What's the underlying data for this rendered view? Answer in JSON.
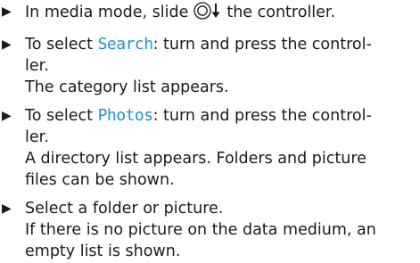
{
  "steps": [
    {
      "before": "In media mode, slide",
      "icon": "controller-slide-down-icon",
      "after": "the controller."
    },
    {
      "prefix": "To select",
      "highlight": "Search",
      "suffix_1": ": turn and press the control-",
      "suffix_2": "ler.",
      "result": "The category list appears."
    },
    {
      "prefix": "To select",
      "highlight": "Photos",
      "suffix_1": ": turn and press the control-",
      "suffix_2": "ler.",
      "result_1": "A directory list appears. Folders and picture",
      "result_2": "files can be shown."
    },
    {
      "line_1": "Select a folder or picture.",
      "line_2": "If there is no picture on the data medium, an",
      "line_3": "empty list is shown."
    }
  ],
  "colors": {
    "highlight": "#1d93c9",
    "text": "#1a1a1a"
  }
}
